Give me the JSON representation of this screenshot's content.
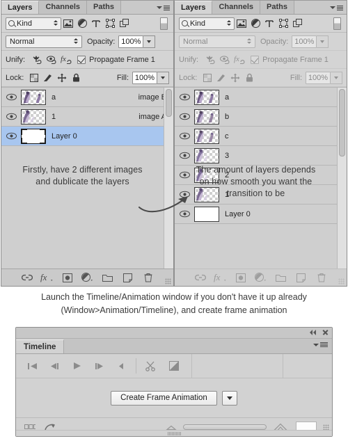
{
  "panels": {
    "left": {
      "tabs": [
        {
          "label": "Layers",
          "active": true,
          "name": "tab-layers"
        },
        {
          "label": "Channels",
          "active": false,
          "name": "tab-channels"
        },
        {
          "label": "Paths",
          "active": false,
          "name": "tab-paths"
        }
      ],
      "filter": {
        "kind_label": "Kind",
        "icons": [
          "pixel-filter-icon",
          "adjustment-filter-icon",
          "type-filter-icon",
          "shape-filter-icon",
          "smart-object-filter-icon"
        ],
        "toggle": "filter-enable-toggle"
      },
      "blend": {
        "mode": "Normal",
        "opacity_label": "Opacity:",
        "opacity_value": "100%"
      },
      "unify": {
        "label": "Unify:",
        "icons": [
          "unify-position-icon",
          "unify-visibility-icon",
          "unify-style-icon"
        ],
        "propagate_label": "Propagate Frame 1",
        "propagate_checked": true
      },
      "lock": {
        "label": "Lock:",
        "icons": [
          "lock-transparency-icon",
          "lock-image-icon",
          "lock-position-icon",
          "lock-all-icon"
        ],
        "fill_label": "Fill:",
        "fill_value": "100%"
      },
      "layers": [
        {
          "name": "a",
          "right": "image B",
          "thumb": "figure",
          "selected": false
        },
        {
          "name": "1",
          "right": "image A",
          "thumb": "figure",
          "selected": false
        },
        {
          "name": "Layer 0",
          "right": "",
          "thumb": "white",
          "selected": true
        }
      ],
      "annotation": [
        "Firstly, have 2 different images",
        "and dublicate the layers"
      ],
      "footer_icons": [
        "link-layers-icon",
        "layer-style-fx-icon",
        "add-mask-icon",
        "adjustment-layer-icon",
        "new-group-icon",
        "new-layer-icon",
        "delete-layer-icon"
      ]
    },
    "right": {
      "tabs": [
        {
          "label": "Layers",
          "active": true,
          "name": "tab-layers"
        },
        {
          "label": "Channels",
          "active": false,
          "name": "tab-channels"
        },
        {
          "label": "Paths",
          "active": false,
          "name": "tab-paths"
        }
      ],
      "filter": {
        "kind_label": "Kind",
        "icons": [
          "pixel-filter-icon",
          "adjustment-filter-icon",
          "type-filter-icon",
          "shape-filter-icon",
          "smart-object-filter-icon"
        ],
        "toggle": "filter-enable-toggle"
      },
      "blend": {
        "mode": "Normal",
        "opacity_label": "Opacity:",
        "opacity_value": "100%"
      },
      "unify": {
        "label": "Unify:",
        "icons": [
          "unify-position-icon",
          "unify-visibility-icon",
          "unify-style-icon"
        ],
        "propagate_label": "Propagate Frame 1",
        "propagate_checked": true
      },
      "lock": {
        "label": "Lock:",
        "icons": [
          "lock-transparency-icon",
          "lock-image-icon",
          "lock-position-icon",
          "lock-all-icon"
        ],
        "fill_label": "Fill:",
        "fill_value": "100%"
      },
      "layers": [
        {
          "name": "a",
          "right": "",
          "thumb": "figure",
          "selected": false
        },
        {
          "name": "b",
          "right": "",
          "thumb": "figure",
          "selected": false
        },
        {
          "name": "c",
          "right": "",
          "thumb": "figure",
          "selected": false
        },
        {
          "name": "3",
          "right": "",
          "thumb": "figure",
          "selected": false
        },
        {
          "name": "2",
          "right": "",
          "thumb": "figure",
          "selected": false
        },
        {
          "name": "1",
          "right": "",
          "thumb": "figure",
          "selected": false
        },
        {
          "name": "Layer 0",
          "right": "",
          "thumb": "white",
          "selected": false
        }
      ],
      "annotation": [
        "The amount of layers depends",
        "on how smooth you want the",
        "transition to be"
      ],
      "footer_icons": [
        "link-layers-icon",
        "layer-style-fx-icon",
        "add-mask-icon",
        "adjustment-layer-icon",
        "new-group-icon",
        "new-layer-icon",
        "delete-layer-icon"
      ]
    }
  },
  "caption": [
    "Launch the Timeline/Animation window if you don't have it up already",
    "(Window>Animation/Timeline), and create frame animation"
  ],
  "timeline": {
    "tab_label": "Timeline",
    "window_buttons": [
      "collapse-to-icons-button",
      "close-panel-button"
    ],
    "transport_icons": [
      "go-to-first-frame-icon",
      "previous-frame-icon",
      "play-icon",
      "next-frame-icon",
      "audio-mute-icon",
      "split-clip-scissors-icon",
      "transition-icon"
    ],
    "create_button_label": "Create Frame Animation",
    "create_dropdown": "create-animation-dropdown",
    "status_icons": [
      "frame-view-icon",
      "render-video-icon",
      "zoom-out-icon",
      "zoom-in-icon"
    ],
    "zoom_slider": "timeline-zoom-slider"
  },
  "colors": {
    "panel_bg": "#d4d4d4",
    "list_bg": "#cfcfcf",
    "selected_row": "#a8c6ef",
    "border": "#8e8e8e",
    "text": "#2b2b2b"
  }
}
